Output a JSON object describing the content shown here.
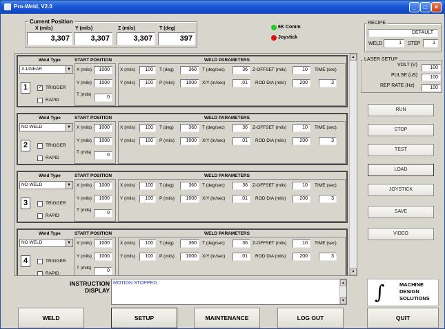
{
  "window": {
    "title": "Pro-Weld, V2.0"
  },
  "current_position": {
    "group_title": "Current Position",
    "x_label": "X (mils)",
    "x_value": "3,307",
    "y_label": "Y (mils)",
    "y_value": "3,307",
    "z_label": "Z (mils)",
    "z_value": "3,307",
    "t_label": "T (deg)",
    "t_value": "397"
  },
  "status": {
    "comm_label": "6K Comm",
    "comm_color": "#22cc22",
    "joystick_label": "Joystick",
    "joystick_color": "#dd1111"
  },
  "recipe": {
    "group_title": "RECIPE",
    "name": "DEFAULT",
    "weld_label": "WELD",
    "weld_value": "1",
    "step_label": "STEP",
    "step_value": "1"
  },
  "laser": {
    "group_title": "LASER SETUP",
    "volt_label": "VOLT (V)",
    "volt_value": "100",
    "pulse_label": "PULSE (uS)",
    "pulse_value": "100",
    "rep_label": "REP RATE (Hz)",
    "rep_value": "100"
  },
  "side_buttons": [
    "RUN",
    "STOP",
    "TEST",
    "LOAD",
    "JOYSTICK",
    "SAVE",
    "VIDEO"
  ],
  "panel_labels": {
    "weld_type": "Weld Type",
    "start_position": "START POSITION",
    "weld_parameters": "WELD PARAMETERS",
    "x_mils": "X (mils)",
    "y_mils": "Y (mils)",
    "t_mils": "T (mils)",
    "t_deg": "T (deg)",
    "p_mils": "P (mils)",
    "t_degsec": "T (deg/sec)",
    "xy_insec": "X/Y (in/sec)",
    "z_offset": "Z-OFFSET (mils)",
    "rod_dia": "ROD DIA (mils)",
    "time_sec": "TIME (sec)",
    "trigger": "TRIGGER",
    "rapid": "RAPID"
  },
  "welds": [
    {
      "number": "1",
      "type": "X-LINEAR",
      "trigger": "✓",
      "rapid": "",
      "sx": "1000",
      "sy": "1000",
      "st": "0",
      "px": "100",
      "py": "100",
      "tdeg": "360",
      "pmils": "1000",
      "tdegsec": "36",
      "xyinsec": ".01",
      "zoff": "10",
      "rod": "200",
      "time": "3"
    },
    {
      "number": "2",
      "type": "NO WELD",
      "trigger": "",
      "rapid": "",
      "sx": "1000",
      "sy": "1000",
      "st": "0",
      "px": "100",
      "py": "100",
      "tdeg": "360",
      "pmils": "1000",
      "tdegsec": "36",
      "xyinsec": ".01",
      "zoff": "10",
      "rod": "200",
      "time": "3"
    },
    {
      "number": "3",
      "type": "NO WELD",
      "trigger": "",
      "rapid": "",
      "sx": "1000",
      "sy": "1000",
      "st": "0",
      "px": "100",
      "py": "100",
      "tdeg": "360",
      "pmils": "1000",
      "tdegsec": "36",
      "xyinsec": ".01",
      "zoff": "10",
      "rod": "200",
      "time": "3"
    },
    {
      "number": "4",
      "type": "NO WELD",
      "trigger": "",
      "rapid": "",
      "sx": "1000",
      "sy": "1000",
      "st": "0",
      "px": "100",
      "py": "100",
      "tdeg": "360",
      "pmils": "1000",
      "tdegsec": "36",
      "xyinsec": ".01",
      "zoff": "10",
      "rod": "200",
      "time": "3"
    }
  ],
  "instruction": {
    "label_line1": "INSTRUCTION",
    "label_line2": "DISPLAY",
    "text": "MOTION STOPPED"
  },
  "logo": {
    "line1": "MACHINE",
    "line2": "DESIGN",
    "line3": "SOLUTIONS"
  },
  "bottom_buttons": [
    "WELD",
    "SETUP",
    "MAINTENANCE",
    "LOG OUT",
    "QUIT"
  ]
}
